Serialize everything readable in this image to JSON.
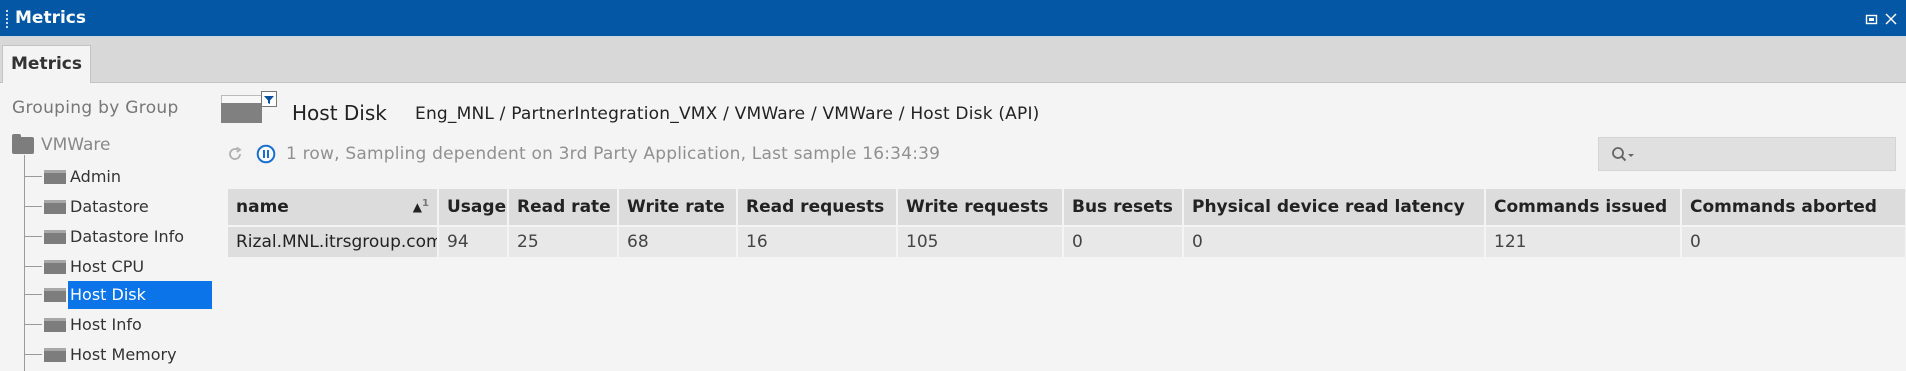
{
  "window": {
    "title": "Metrics",
    "accent_color": "#0357a4"
  },
  "tabs": [
    {
      "label": "Metrics",
      "active": true
    }
  ],
  "sidebar": {
    "heading": "Grouping by Group",
    "root": {
      "label": "VMWare",
      "icon": "folder-icon"
    },
    "items": [
      {
        "label": "Admin",
        "selected": false
      },
      {
        "label": "Datastore",
        "selected": false
      },
      {
        "label": "Datastore Info",
        "selected": false
      },
      {
        "label": "Host CPU",
        "selected": false
      },
      {
        "label": "Host Disk",
        "selected": true
      },
      {
        "label": "Host Info",
        "selected": false
      },
      {
        "label": "Host Memory",
        "selected": false
      }
    ],
    "selection_color": "#0a74e8"
  },
  "view": {
    "title": "Host Disk",
    "breadcrumb": "Eng_MNL / PartnerIntegration_VMX / VMWare / VMWare / Host Disk (API)",
    "status": "1 row, Sampling dependent on 3rd Party Application, Last sample 16:34:39",
    "icons": [
      "dataview-icon",
      "filter-icon",
      "refresh-icon",
      "pause-icon",
      "search-icon"
    ]
  },
  "table": {
    "sort": {
      "column": "name",
      "direction": "ascending",
      "priority": "1"
    },
    "columns": [
      "name",
      "Usage",
      "Read rate",
      "Write rate",
      "Read requests",
      "Write requests",
      "Bus resets",
      "Physical device read latency",
      "Commands issued",
      "Commands aborted"
    ],
    "rows": [
      [
        "Rizal.MNL.itrsgroup.com",
        "94",
        "25",
        "68",
        "16",
        "105",
        "0",
        "0",
        "121",
        "0"
      ]
    ]
  }
}
